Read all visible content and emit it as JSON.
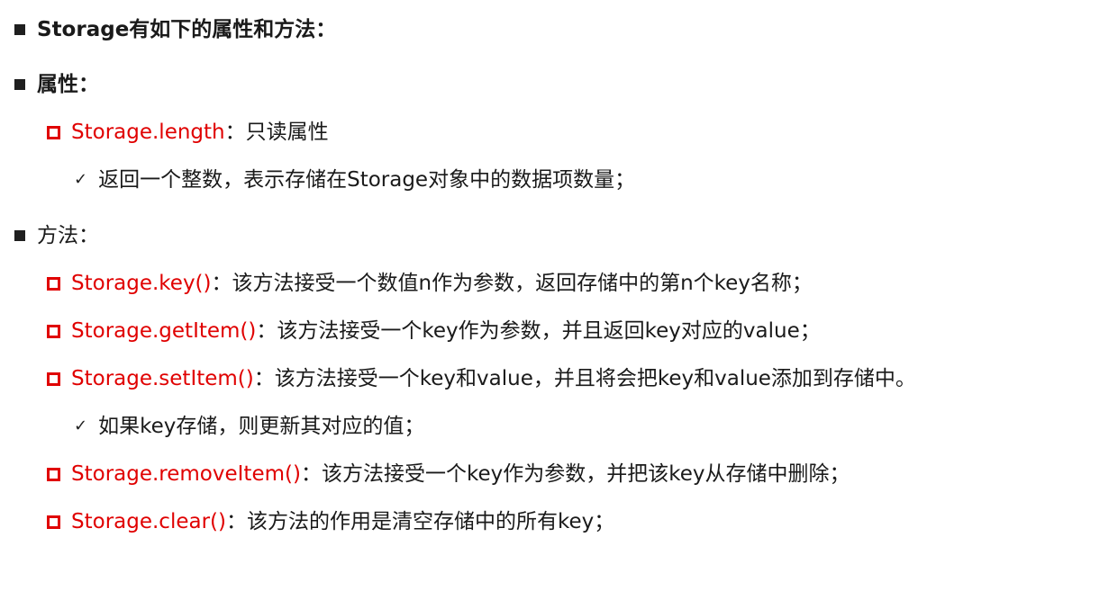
{
  "items": [
    {
      "text": "Storage有如下的属性和方法："
    },
    {
      "text": "属性："
    },
    {
      "name": "Storage.length",
      "desc": "：只读属性"
    },
    {
      "text": "返回一个整数，表示存储在Storage对象中的数据项数量；"
    },
    {
      "text": "方法："
    },
    {
      "name": "Storage.key()",
      "desc": "：该方法接受一个数值n作为参数，返回存储中的第n个key名称；"
    },
    {
      "name": "Storage.getItem()",
      "desc": "：该方法接受一个key作为参数，并且返回key对应的value；"
    },
    {
      "name": "Storage.setItem()",
      "desc": "：该方法接受一个key和value，并且将会把key和value添加到存储中。"
    },
    {
      "text": "如果key存储，则更新其对应的值；"
    },
    {
      "name": "Storage.removeItem()",
      "desc": "：该方法接受一个key作为参数，并把该key从存储中删除；"
    },
    {
      "name": "Storage.clear()",
      "desc": "：该方法的作用是清空存储中的所有key；"
    }
  ],
  "colors": {
    "accent_red": "#e00000",
    "text": "#1a1a1a"
  },
  "icons": {
    "level1": "square-bullet-icon",
    "level2": "hollow-square-bullet-icon",
    "level3": "checkmark-icon"
  }
}
